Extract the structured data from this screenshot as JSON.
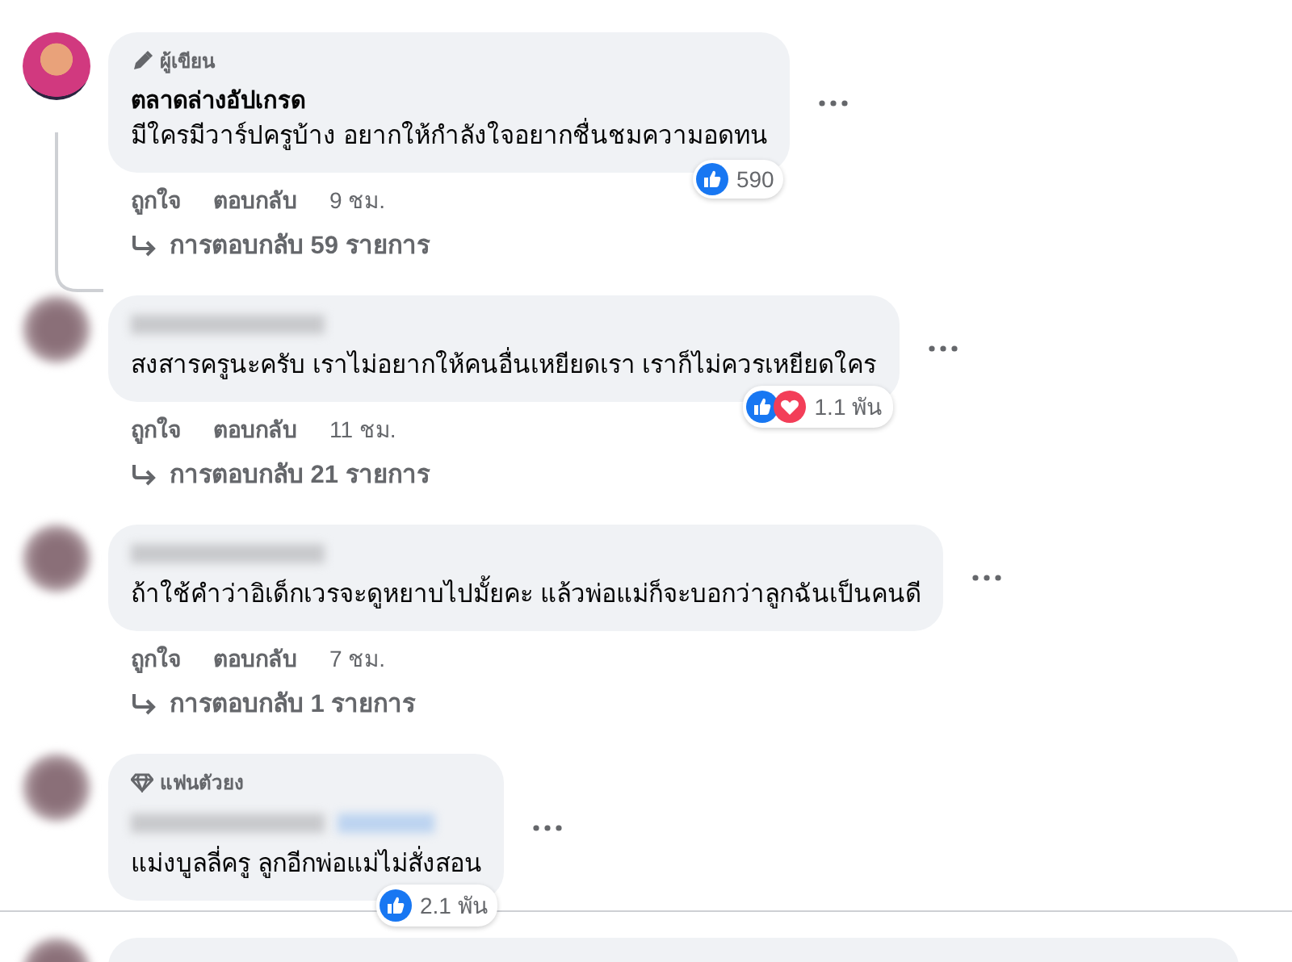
{
  "comments": [
    {
      "avatar": {
        "kind": "picture"
      },
      "badge": {
        "kind": "author",
        "label": "ผู้เขียน"
      },
      "name": "ตลาดล่างอัปเกรด",
      "name_blurred": false,
      "text": "มีใครมีวาร์ปครูบ้าง อยากให้กำลังใจอยากชื่นชมความอดทน",
      "reactions": {
        "icons": [
          {
            "kind": "like"
          }
        ],
        "count": "590"
      },
      "actions": [
        "ถูกใจ",
        "ตอบกลับ"
      ],
      "time": "9 ชม.",
      "replies": "การตอบกลับ 59 รายการ"
    },
    {
      "avatar": {
        "kind": "blurred"
      },
      "name_blurred": true,
      "text": "สงสารครูนะครับ เราไม่อยากให้คนอื่นเหยียดเรา เราก็ไม่ควรเหยียดใคร",
      "reactions": {
        "icons": [
          {
            "kind": "like"
          },
          {
            "kind": "love"
          }
        ],
        "count": "1.1 พัน"
      },
      "actions": [
        "ถูกใจ",
        "ตอบกลับ"
      ],
      "time": "11 ชม.",
      "replies": "การตอบกลับ 21 รายการ"
    },
    {
      "avatar": {
        "kind": "blurred"
      },
      "name_blurred": true,
      "text": "ถ้าใช้คำว่าอิเด็กเวรจะดูหยาบไปมั้ยคะ แล้วพ่อแม่ก็จะบอกว่าลูกฉันเป็นคนดี",
      "actions": [
        "ถูกใจ",
        "ตอบกลับ"
      ],
      "time": "7 ชม.",
      "replies": "การตอบกลับ 1 รายการ"
    },
    {
      "avatar": {
        "kind": "blurred"
      },
      "badge": {
        "kind": "fan",
        "label": "แฟนตัวยง"
      },
      "name_blurred": true,
      "name_tag_blurred": true,
      "text": "แม่งบูลลี่ครู ลูกอีกพ่อแม่ไม่สั่งสอน",
      "reactions": {
        "icons": [
          {
            "kind": "like"
          }
        ],
        "count": "2.1 พัน"
      }
    }
  ]
}
